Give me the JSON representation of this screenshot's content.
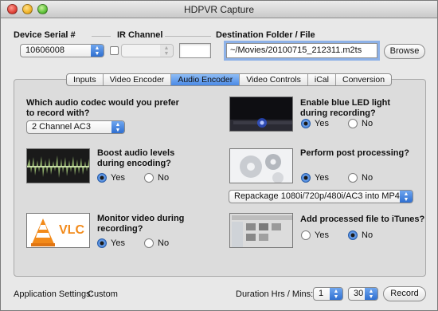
{
  "window": {
    "title": "HDPVR Capture"
  },
  "top": {
    "device_serial_label": "Device Serial #",
    "device_serial_value": "10606008",
    "ir_channel_label": "IR Channel",
    "ir_channel_value": "",
    "ir_channel_text": "",
    "destination_label": "Destination Folder / File",
    "destination_value": "~/Movies/20100715_212311.m2ts",
    "browse_label": "Browse"
  },
  "tabs": [
    {
      "label": "Inputs"
    },
    {
      "label": "Video Encoder"
    },
    {
      "label": "Audio Encoder"
    },
    {
      "label": "Video Controls"
    },
    {
      "label": "iCal"
    },
    {
      "label": "Conversion"
    }
  ],
  "active_tab": "Audio Encoder",
  "audio": {
    "codec_question": "Which audio codec would you prefer to record with?",
    "codec_value": "2 Channel AC3",
    "boost_question": "Boost audio levels during encoding?",
    "boost_yes": "Yes",
    "boost_no": "No",
    "boost_selected": "Yes",
    "monitor_question": "Monitor video during recording?",
    "monitor_yes": "Yes",
    "monitor_no": "No",
    "monitor_selected": "Yes",
    "vlc_text": "VLC",
    "led_question": "Enable blue LED light during recording?",
    "led_yes": "Yes",
    "led_no": "No",
    "led_selected": "Yes",
    "post_question": "Perform post processing?",
    "post_yes": "Yes",
    "post_no": "No",
    "post_selected": "Yes",
    "post_option": "Repackage 1080i/720p/480i/AC3 into MP4",
    "itunes_question": "Add processed file to iTunes?",
    "itunes_yes": "Yes",
    "itunes_no": "No",
    "itunes_selected": "No"
  },
  "footer": {
    "app_settings_label": "Application Settings:",
    "app_settings_value": "Custom",
    "duration_label": "Duration Hrs / Mins:",
    "hours_value": "1",
    "minutes_value": "30",
    "record_label": "Record"
  },
  "colors": {
    "accent": "#3d7ee0",
    "panel": "#dcdcdc",
    "window": "#e8e8e8"
  }
}
